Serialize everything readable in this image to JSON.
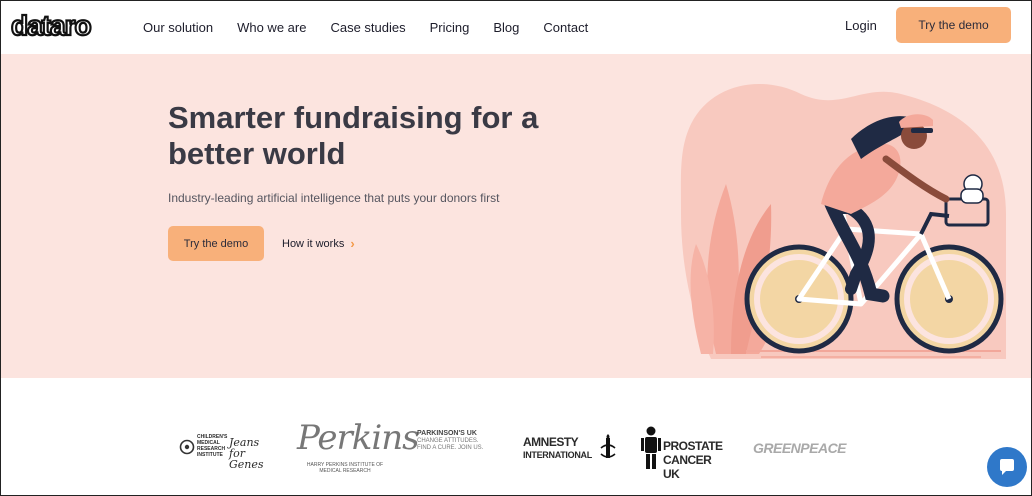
{
  "brand": {
    "logo_text": "dataro"
  },
  "nav": {
    "items": [
      {
        "label": "Our solution"
      },
      {
        "label": "Who we are"
      },
      {
        "label": "Case studies"
      },
      {
        "label": "Pricing"
      },
      {
        "label": "Blog"
      },
      {
        "label": "Contact"
      }
    ],
    "login_label": "Login",
    "demo_label": "Try the demo"
  },
  "hero": {
    "title": "Smarter fundraising for a better world",
    "subtitle": "Industry-leading artificial intelligence that puts your donors first",
    "primary_button": "Try the demo",
    "secondary_link": "How it works",
    "secondary_icon": "chevron-right-icon",
    "background_color": "#fce4df",
    "illustration": "cyclist-illustration"
  },
  "partners": {
    "cmri": {
      "lines": [
        "CHILDREN'S",
        "MEDICAL",
        "RESEARCH",
        "INSTITUTE"
      ],
      "script": "Jeans for Genes"
    },
    "perkins": {
      "signature": "Perkins",
      "caption": "HARRY PERKINS INSTITUTE OF MEDICAL RESEARCH"
    },
    "parkinsons": {
      "name": "PARKINSON'S UK",
      "tagline": "CHANGE ATTITUDES. FIND A CURE. JOIN US."
    },
    "amnesty": {
      "line1": "AMNESTY",
      "line2": "INTERNATIONAL"
    },
    "prostate": {
      "line1": "PROSTATE",
      "line2": "CANCER UK"
    },
    "greenpeace": {
      "name": "GREENPEACE"
    }
  },
  "colors": {
    "accent": "#f8b07a",
    "hero_bg": "#fce4df",
    "chat": "#2f78c9",
    "text_dark": "#3a3a45"
  },
  "chat": {
    "icon": "chat-bubble-icon"
  }
}
